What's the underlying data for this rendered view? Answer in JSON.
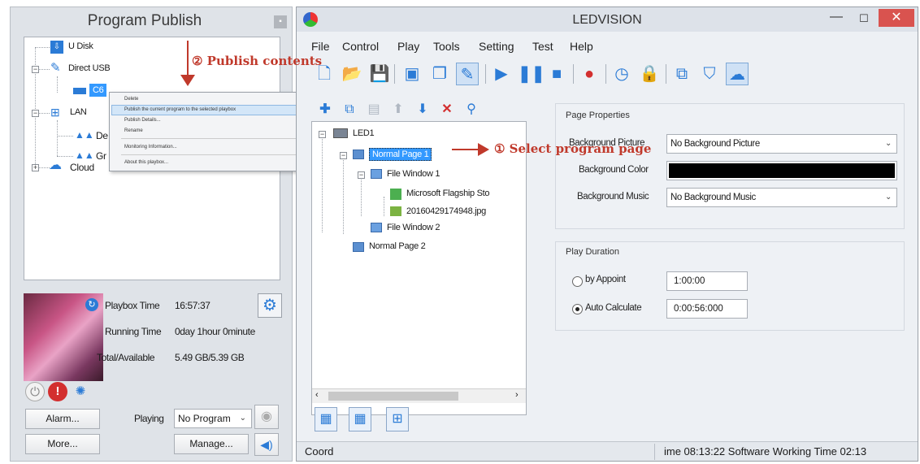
{
  "left_panel": {
    "title": "Program Publish",
    "close_glyph": "▪",
    "tree": {
      "udisk": "U Disk",
      "direct_usb": "Direct USB",
      "selected_device": "C6",
      "lan": "LAN",
      "lan_child_1": "De",
      "lan_child_2": "Gr",
      "cloud": "Cloud"
    },
    "context_menu": [
      "Delete",
      "Publish the current program to the selected playbox",
      "Publish Details...",
      "Rename",
      "Monitoring Information...",
      "About this playbox..."
    ],
    "info": {
      "playbox_time_label": "Playbox Time",
      "playbox_time_value": "16:57:37",
      "running_time_label": "Running Time",
      "running_time_value": "0day 1hour 0minute",
      "storage_label": "Total/Available",
      "storage_value": "5.49 GB/5.39 GB"
    },
    "buttons": {
      "alarm": "Alarm...",
      "more": "More...",
      "manage": "Manage...",
      "playing_label": "Playing",
      "playing_value": "No Program"
    },
    "icons": [
      "usb-drive-icon",
      "usb-cable-icon",
      "playbox-icon",
      "lan-icon",
      "group-icon",
      "cloud-icon",
      "gear-icon",
      "power-icon",
      "shutdown-icon",
      "brightness-icon",
      "eye-icon",
      "speaker-icon"
    ]
  },
  "window": {
    "title": "LEDVISION",
    "menu": [
      "File",
      "Control",
      "Play",
      "Tools",
      "Setting",
      "Test",
      "Help"
    ],
    "program_tree": {
      "root": "LED1",
      "page1": "Normal Page 1",
      "window1": "File Window 1",
      "file1": "Microsoft Flagship Sto",
      "file2": "20160429174948.jpg",
      "window2": "File Window 2",
      "page2": "Normal Page 2"
    },
    "page_properties": {
      "title": "Page Properties",
      "bg_picture_label": "Background Picture",
      "bg_picture_value": "No Background Picture",
      "bg_color_label": "Background Color",
      "bg_color_value": "#000000",
      "bg_music_label": "Background Music",
      "bg_music_value": "No Background Music"
    },
    "play_duration": {
      "title": "Play Duration",
      "by_appoint_label": "by Appoint",
      "by_appoint_value": "1:00:00",
      "auto_calc_label": "Auto Calculate",
      "auto_calc_value": "0:00:56:000",
      "selected": "auto"
    },
    "status": {
      "coord": "Coord",
      "time": "ime 08:13:22 Software Working Time 02:13"
    }
  },
  "annotations": {
    "step1": "① Select program page",
    "step2": "② Publish contents"
  },
  "colors": {
    "accent": "#2b7bd6",
    "annotation": "#c0392b",
    "selection": "#3399ff",
    "close": "#d9534f"
  }
}
